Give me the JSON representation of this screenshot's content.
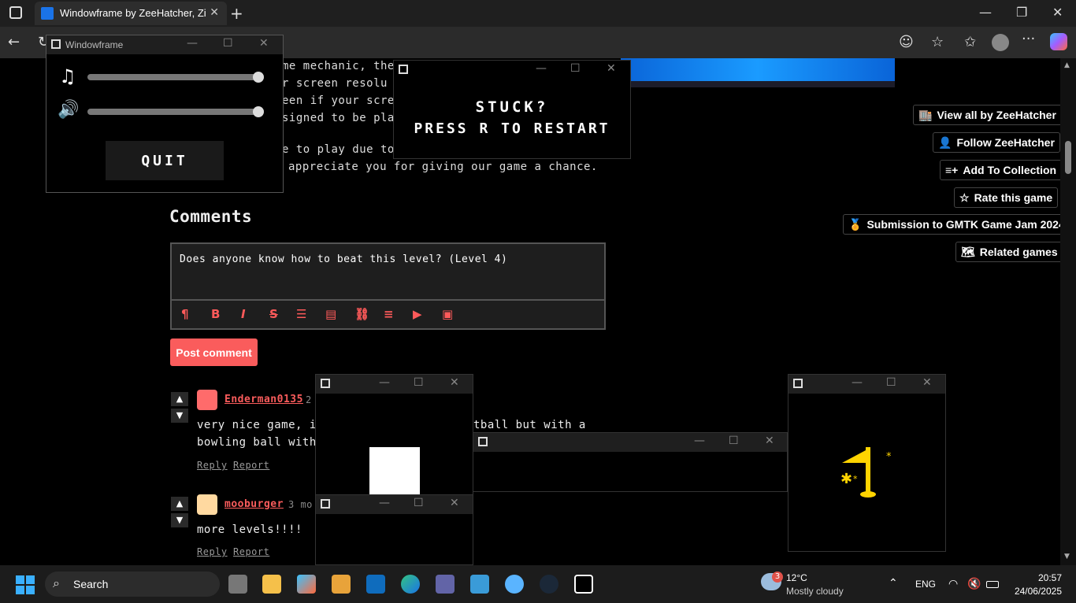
{
  "browser": {
    "tab_title": "Windowframe by ZeeHatcher, Zin",
    "tab_close": "✕",
    "new_tab": "+",
    "minimize": "—",
    "maximize": "❐",
    "close": "✕",
    "back": "←",
    "reload": "↻",
    "more": "···"
  },
  "page": {
    "description_lines": [
      "me mechanic, the",
      "r screen resolu",
      "een if your scree",
      "signed to be pla",
      "e to play due to",
      "appreciate you for giving our game a chance."
    ],
    "comments_heading": "Comments",
    "comment_input_value": "Does anyone know how to beat this level? (Level 4)",
    "editor_buttons": [
      "¶",
      "B",
      "I",
      "S",
      "☰",
      "▤",
      "⛓",
      "≡",
      "▶",
      "▣"
    ],
    "post_button": "Post comment",
    "comments": [
      {
        "username": "Enderman0135",
        "meta": "2",
        "line1": "very nice game, i",
        "line1b": "tball but with a",
        "line2": "bowling ball with s",
        "reply": "Reply",
        "report": "Report"
      },
      {
        "username": "mooburger",
        "meta": "3 mo",
        "line1": "more levels!!!!",
        "reply": "Reply",
        "report": "Report"
      }
    ],
    "side_buttons": [
      {
        "icon": "🏬",
        "label": "View all by ZeeHatcher"
      },
      {
        "icon": "👤",
        "label": "Follow ZeeHatcher"
      },
      {
        "icon": "≡+",
        "label": "Add To Collection"
      },
      {
        "icon": "☆",
        "label": "Rate this game"
      },
      {
        "icon": "🏅",
        "label": "Submission to GMTK Game Jam 2024"
      },
      {
        "icon": "🗺",
        "label": "Related games"
      }
    ]
  },
  "game": {
    "settings_window_title": "Windowframe",
    "music_level": 1.0,
    "sfx_level": 1.0,
    "quit_label": "QUIT",
    "stuck_line1": "STUCK?",
    "stuck_line2": "PRESS R TO RESTART",
    "win_min": "—",
    "win_max": "☐",
    "win_close": "✕",
    "flag_color": "#ffd400"
  },
  "taskbar": {
    "search_label": "Search",
    "weather_badge": "3",
    "weather_temp": "12°C",
    "weather_desc": "Mostly cloudy",
    "language": "ENG",
    "time": "20:57",
    "date": "24/06/2025"
  }
}
